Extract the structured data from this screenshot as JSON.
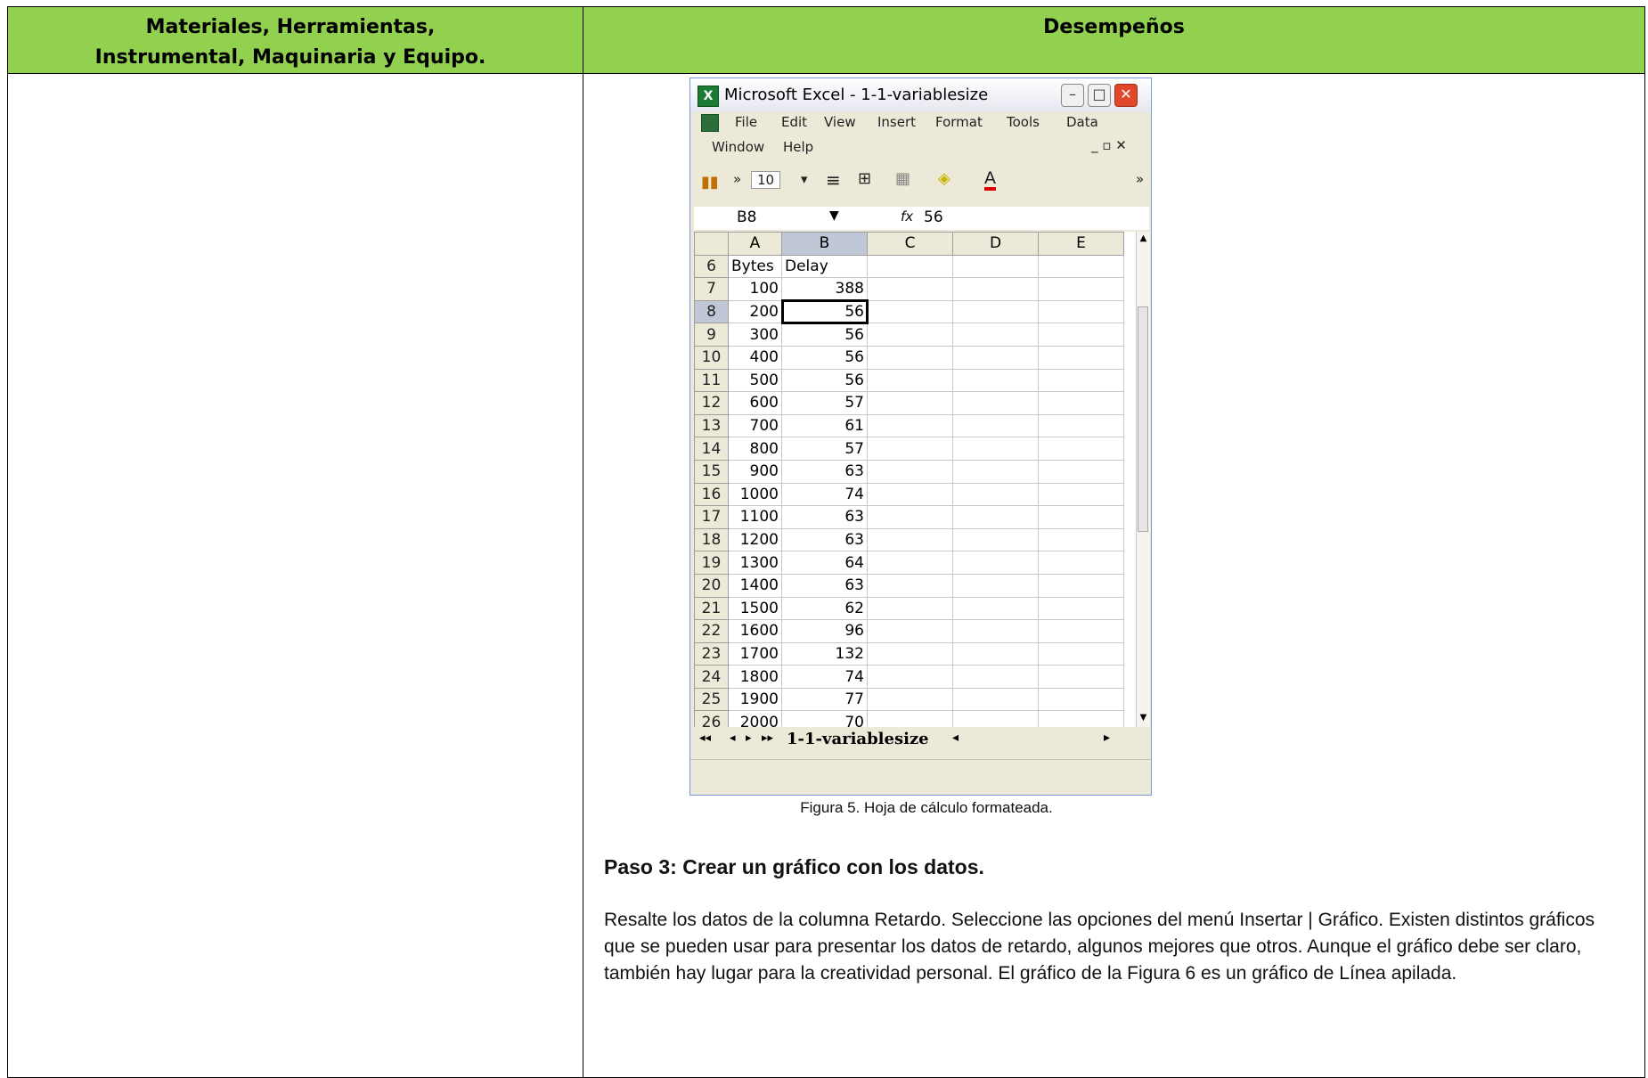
{
  "header": {
    "left_title": "Materiales, Herramientas, Instrumental, Maquinaria y Equipo.",
    "right_title": "Desempeños"
  },
  "excel": {
    "window_title": "Microsoft Excel - 1-1-variablesize",
    "menu": [
      "File",
      "Edit",
      "View",
      "Insert",
      "Format",
      "Tools",
      "Data",
      "Window",
      "Help"
    ],
    "toolbar": {
      "font_size": "10"
    },
    "name_box": "B8",
    "fx_label": "fx",
    "formula_value": "56",
    "columns": [
      "A",
      "B",
      "C",
      "D",
      "E"
    ],
    "rows": [
      {
        "n": "6",
        "a": "Bytes",
        "b": "Delay"
      },
      {
        "n": "7",
        "a": "100",
        "b": "388"
      },
      {
        "n": "8",
        "a": "200",
        "b": "56"
      },
      {
        "n": "9",
        "a": "300",
        "b": "56"
      },
      {
        "n": "10",
        "a": "400",
        "b": "56"
      },
      {
        "n": "11",
        "a": "500",
        "b": "56"
      },
      {
        "n": "12",
        "a": "600",
        "b": "57"
      },
      {
        "n": "13",
        "a": "700",
        "b": "61"
      },
      {
        "n": "14",
        "a": "800",
        "b": "57"
      },
      {
        "n": "15",
        "a": "900",
        "b": "63"
      },
      {
        "n": "16",
        "a": "1000",
        "b": "74"
      },
      {
        "n": "17",
        "a": "1100",
        "b": "63"
      },
      {
        "n": "18",
        "a": "1200",
        "b": "63"
      },
      {
        "n": "19",
        "a": "1300",
        "b": "64"
      },
      {
        "n": "20",
        "a": "1400",
        "b": "63"
      },
      {
        "n": "21",
        "a": "1500",
        "b": "62"
      },
      {
        "n": "22",
        "a": "1600",
        "b": "96"
      },
      {
        "n": "23",
        "a": "1700",
        "b": "132"
      },
      {
        "n": "24",
        "a": "1800",
        "b": "74"
      },
      {
        "n": "25",
        "a": "1900",
        "b": "77"
      },
      {
        "n": "26",
        "a": "2000",
        "b": "70"
      }
    ],
    "active_row": "8",
    "sheet_tab": "1-1-variablesize"
  },
  "caption": "Figura 5. Hoja de cálculo formateada.",
  "step_title": "Paso 3: Crear un gráfico con los datos.",
  "paragraph": "Resalte los datos de la columna Retardo. Seleccione las opciones del menú Insertar | Gráfico. Existen distintos gráficos que se pueden usar para presentar los datos de retardo, algunos mejores que otros. Aunque el gráfico debe ser claro, también hay lugar para la creatividad personal. El gráfico de la Figura 6 es un gráfico de Línea apilada."
}
